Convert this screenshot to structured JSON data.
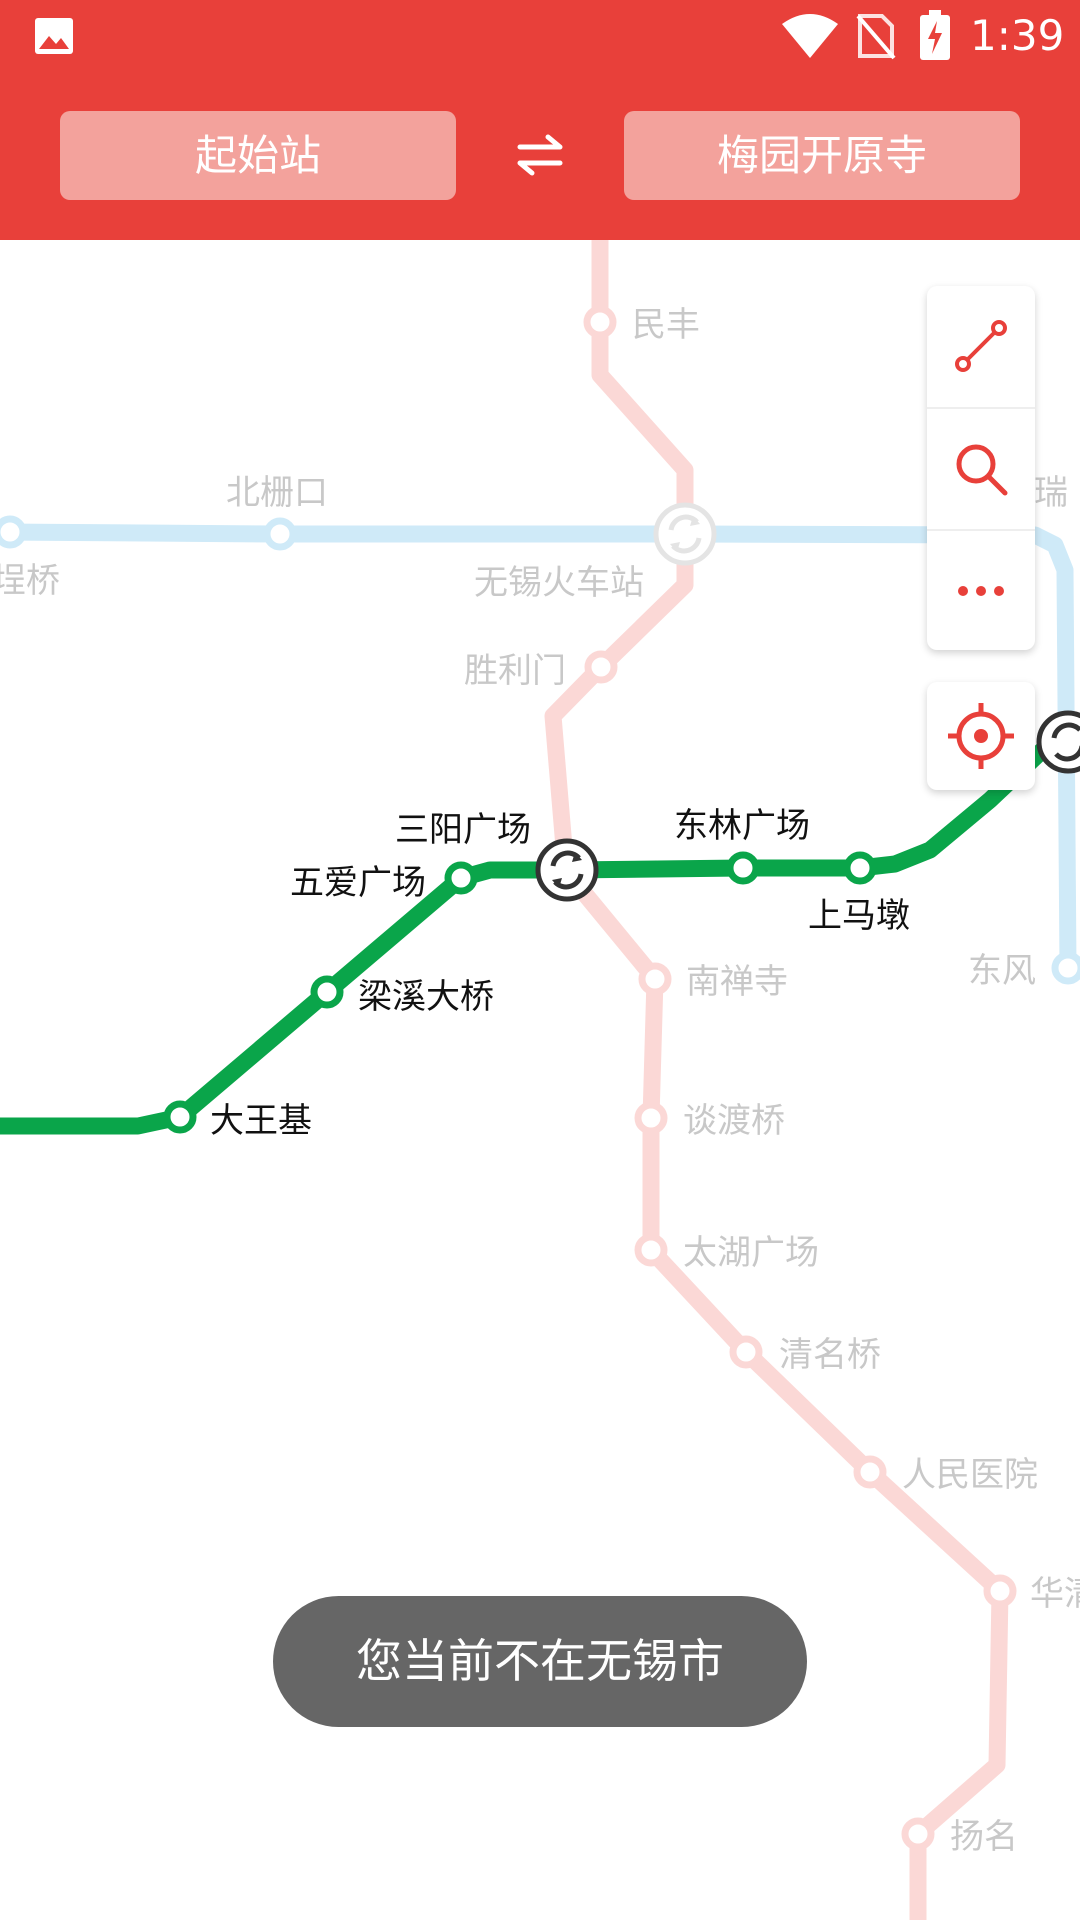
{
  "status_bar": {
    "time": "1:39",
    "icons": [
      "gallery-icon",
      "wifi-icon",
      "no-sim-icon",
      "battery-charging-icon"
    ]
  },
  "route_selector": {
    "start_label": "起始站",
    "end_label": "梅园开原寺",
    "swap_icon": "swap-icon"
  },
  "map_tools": {
    "items": [
      "route-icon",
      "search-icon",
      "more-icon"
    ],
    "locate": "locate-icon"
  },
  "colors": {
    "header": "#e8403a",
    "button": "#f3a29c",
    "active_line": "#0aa54a",
    "faded_red_line": "#fbd8d6",
    "faded_blue_line": "#cfeaf8",
    "accent_icon": "#e8403a"
  },
  "stations": {
    "minfeng": "民丰",
    "beizhakou": "北栅口",
    "qiao_partial": "埕桥",
    "wuxi_station": "无锡火车站",
    "shenglimen": "胜利门",
    "rui_partial": "瑞",
    "sanyang": "三阳广场",
    "donglin": "东林广场",
    "wuai": "五爱广场",
    "shangmadun": "上马墩",
    "dongfeng": "东风",
    "nanchansi": "南禅寺",
    "liangxi": "梁溪大桥",
    "dawangji": "大王基",
    "tandu": "谈渡桥",
    "taihu": "太湖广场",
    "qingming": "清名桥",
    "hospital": "人民医院",
    "hua_partial": "华清",
    "yangming": "扬名"
  },
  "toast": "您当前不在无锡市"
}
